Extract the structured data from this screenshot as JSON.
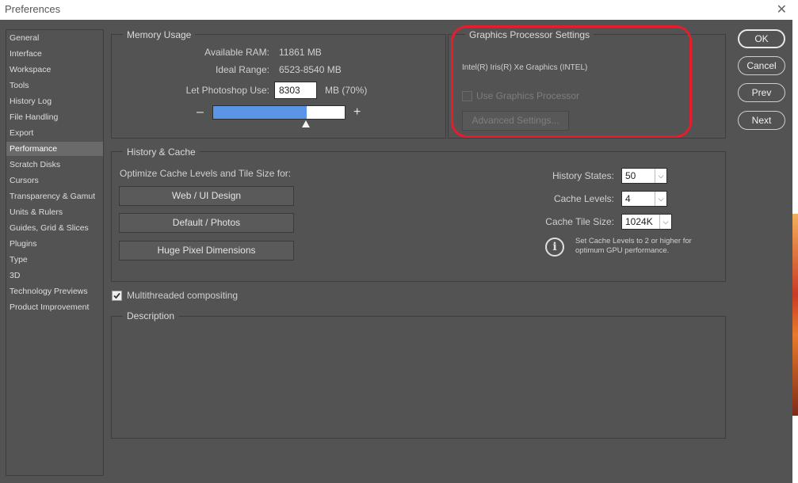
{
  "window": {
    "title": "Preferences",
    "close_glyph": "✕"
  },
  "sidebar": {
    "items": [
      {
        "label": "General"
      },
      {
        "label": "Interface"
      },
      {
        "label": "Workspace"
      },
      {
        "label": "Tools"
      },
      {
        "label": "History Log"
      },
      {
        "label": "File Handling"
      },
      {
        "label": "Export"
      },
      {
        "label": "Performance",
        "selected": true
      },
      {
        "label": "Scratch Disks"
      },
      {
        "label": "Cursors"
      },
      {
        "label": "Transparency & Gamut"
      },
      {
        "label": "Units & Rulers"
      },
      {
        "label": "Guides, Grid & Slices"
      },
      {
        "label": "Plugins"
      },
      {
        "label": "Type"
      },
      {
        "label": "3D"
      },
      {
        "label": "Technology Previews"
      },
      {
        "label": "Product Improvement"
      }
    ]
  },
  "memory": {
    "title": "Memory Usage",
    "available_label": "Available RAM:",
    "available_value": "11861 MB",
    "ideal_label": "Ideal Range:",
    "ideal_value": "6523-8540 MB",
    "use_label": "Let Photoshop Use:",
    "use_value": "8303",
    "use_unit": "MB (70%)",
    "slider_fraction": 0.7,
    "minus": "–",
    "plus": "+",
    "slider_color": "#5b95e6"
  },
  "gpu": {
    "title": "Graphics Processor Settings",
    "device": "Intel(R) Iris(R) Xe Graphics (INTEL)",
    "use_label": "Use Graphics Processor",
    "use_checked": false,
    "advanced_label": "Advanced Settings...",
    "highlight_color": "#e51d2c"
  },
  "history_cache": {
    "title": "History & Cache",
    "optimize_label": "Optimize Cache Levels and Tile Size for:",
    "buttons": [
      "Web / UI Design",
      "Default / Photos",
      "Huge Pixel Dimensions"
    ],
    "history_states_label": "History States:",
    "history_states_value": "50",
    "cache_levels_label": "Cache Levels:",
    "cache_levels_value": "4",
    "tile_size_label": "Cache Tile Size:",
    "tile_size_value": "1024K",
    "info_icon": "info-icon",
    "info_text_1": "Set Cache Levels to 2 or higher for",
    "info_text_2": "optimum GPU performance."
  },
  "multithreaded": {
    "label": "Multithreaded compositing",
    "checked": true
  },
  "description": {
    "title": "Description"
  },
  "actions": {
    "ok": "OK",
    "cancel": "Cancel",
    "prev": "Prev",
    "next": "Next"
  }
}
